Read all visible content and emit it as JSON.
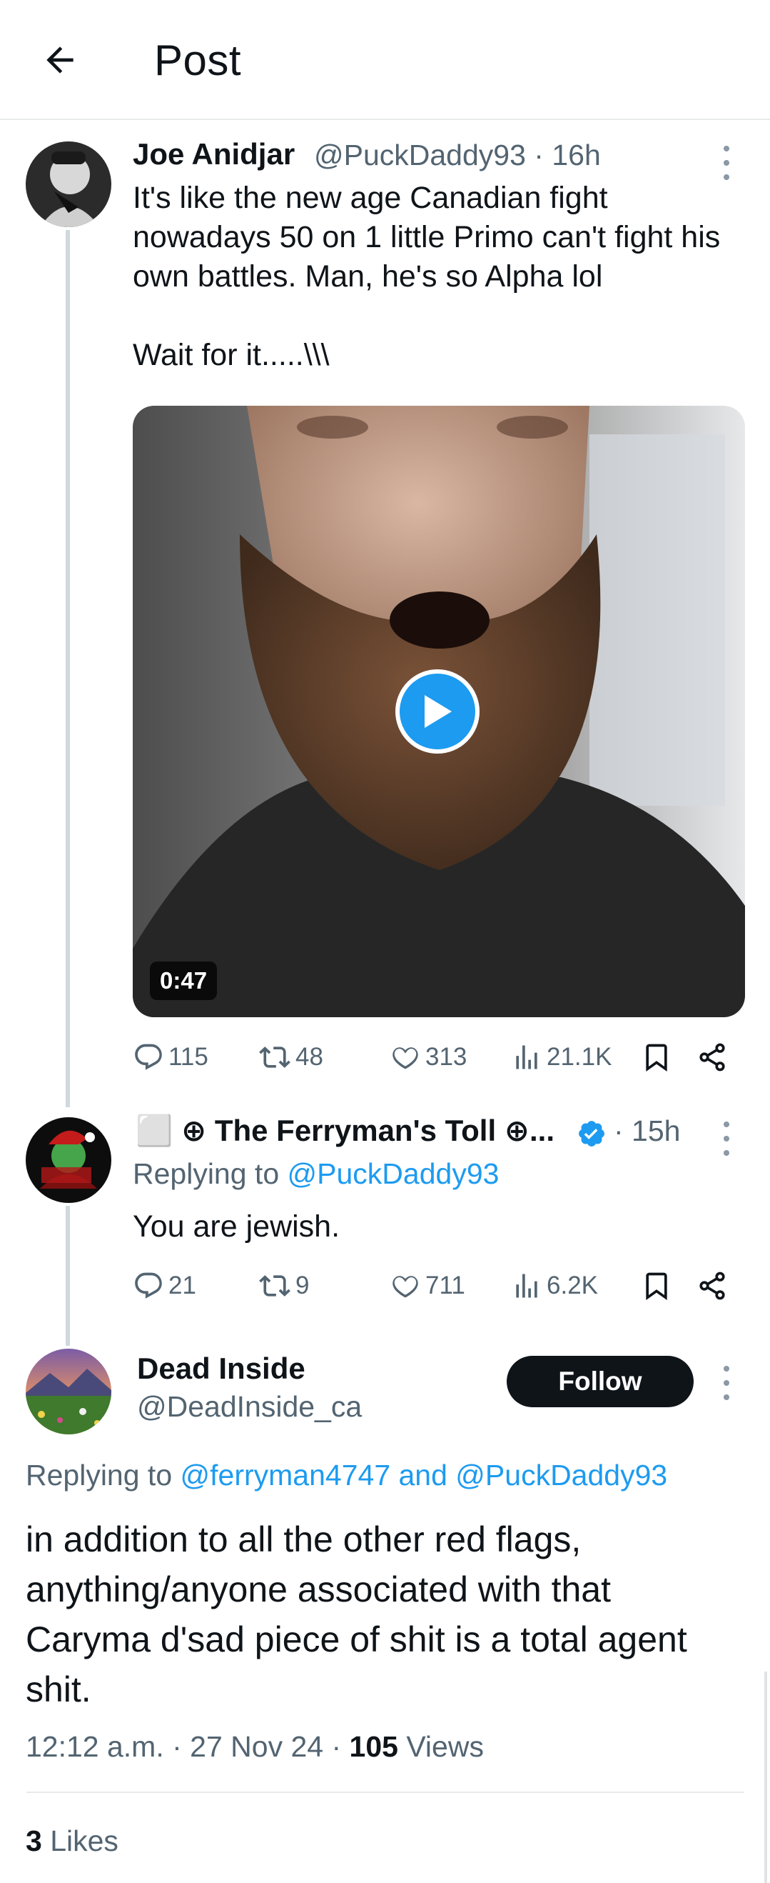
{
  "header": {
    "title": "Post"
  },
  "tweet1": {
    "name": "Joe Anidjar",
    "handle": "@PuckDaddy93",
    "time": "· 16h",
    "text": "It's like the new age Canadian fight nowadays 50 on 1 little Primo can't fight his own battles. Man, he's so Alpha lol\n\nWait for it.....\\\\\\",
    "video_duration": "0:47",
    "replies": "115",
    "reposts": "48",
    "likes": "313",
    "views": "21.1K"
  },
  "tweet2": {
    "name": "⬜ ⊕ The Ferryman's Toll ⊕...",
    "time": "· 15h",
    "replying_prefix": "Replying to",
    "replying_to": "@PuckDaddy93",
    "text": "You are jewish.",
    "replies": "21",
    "reposts": "9",
    "likes": "711",
    "views": "6.2K",
    "verified_color": "#1d9bf0"
  },
  "main_post": {
    "name": "Dead Inside",
    "handle": "@DeadInside_ca",
    "follow_label": "Follow",
    "replying_prefix": "Replying to",
    "replying_to": "@ferryman4747 and @PuckDaddy93",
    "text": "in addition to all the other red flags, anything/anyone associated with that Caryma d'sad piece of shit is a total agent shit.",
    "timestamp": "12:12 a.m. · 27 Nov 24 · ",
    "views_count": "105",
    "views_label": " Views",
    "likes_count": "3",
    "likes_label": " Likes"
  },
  "colors": {
    "accent": "#1d9bf0",
    "text": "#0f1419",
    "muted": "#536471",
    "divider": "#e7e9ea"
  },
  "icons": [
    "back-arrow-icon",
    "more-icon",
    "reply-icon",
    "repost-icon",
    "like-icon",
    "views-icon",
    "bookmark-icon",
    "share-icon",
    "play-icon",
    "verified-badge-icon"
  ]
}
